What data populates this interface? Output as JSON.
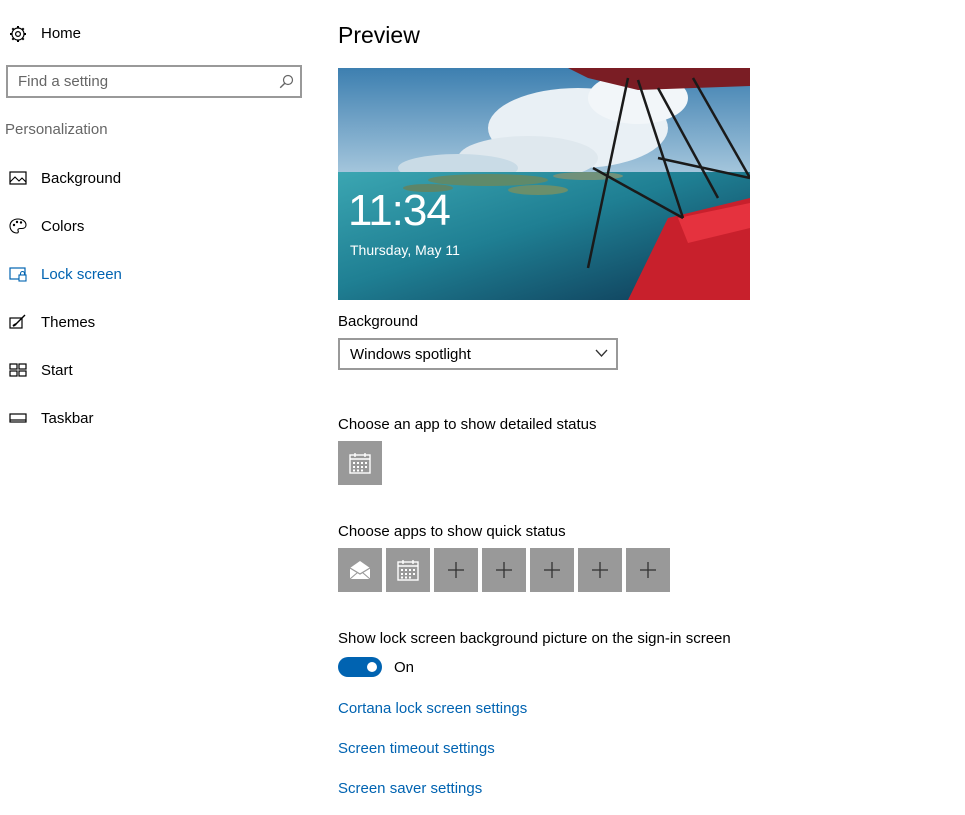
{
  "sidebar": {
    "home_label": "Home",
    "search": {
      "placeholder": "Find a setting",
      "value": ""
    },
    "section_label": "Personalization",
    "items": [
      {
        "label": "Background",
        "icon": "picture-icon"
      },
      {
        "label": "Colors",
        "icon": "palette-icon"
      },
      {
        "label": "Lock screen",
        "icon": "lock-screen-icon",
        "active": true
      },
      {
        "label": "Themes",
        "icon": "themes-icon"
      },
      {
        "label": "Start",
        "icon": "start-icon"
      },
      {
        "label": "Taskbar",
        "icon": "taskbar-icon"
      }
    ]
  },
  "main": {
    "title": "Preview",
    "preview": {
      "time": "11:34",
      "date": "Thursday, May 11"
    },
    "background": {
      "label": "Background",
      "selected": "Windows spotlight"
    },
    "detailed_status": {
      "label": "Choose an app to show detailed status",
      "tiles": [
        "calendar-icon"
      ]
    },
    "quick_status": {
      "label": "Choose apps to show quick status",
      "tiles": [
        "mail-icon",
        "calendar-icon",
        "plus-icon",
        "plus-icon",
        "plus-icon",
        "plus-icon",
        "plus-icon"
      ]
    },
    "signin_bg": {
      "label": "Show lock screen background picture on the sign-in screen",
      "state": "On"
    },
    "links": [
      "Cortana lock screen settings",
      "Screen timeout settings",
      "Screen saver settings"
    ]
  },
  "colors": {
    "accent": "#0063b1",
    "tile": "#999999",
    "secondary_text": "#666666"
  }
}
